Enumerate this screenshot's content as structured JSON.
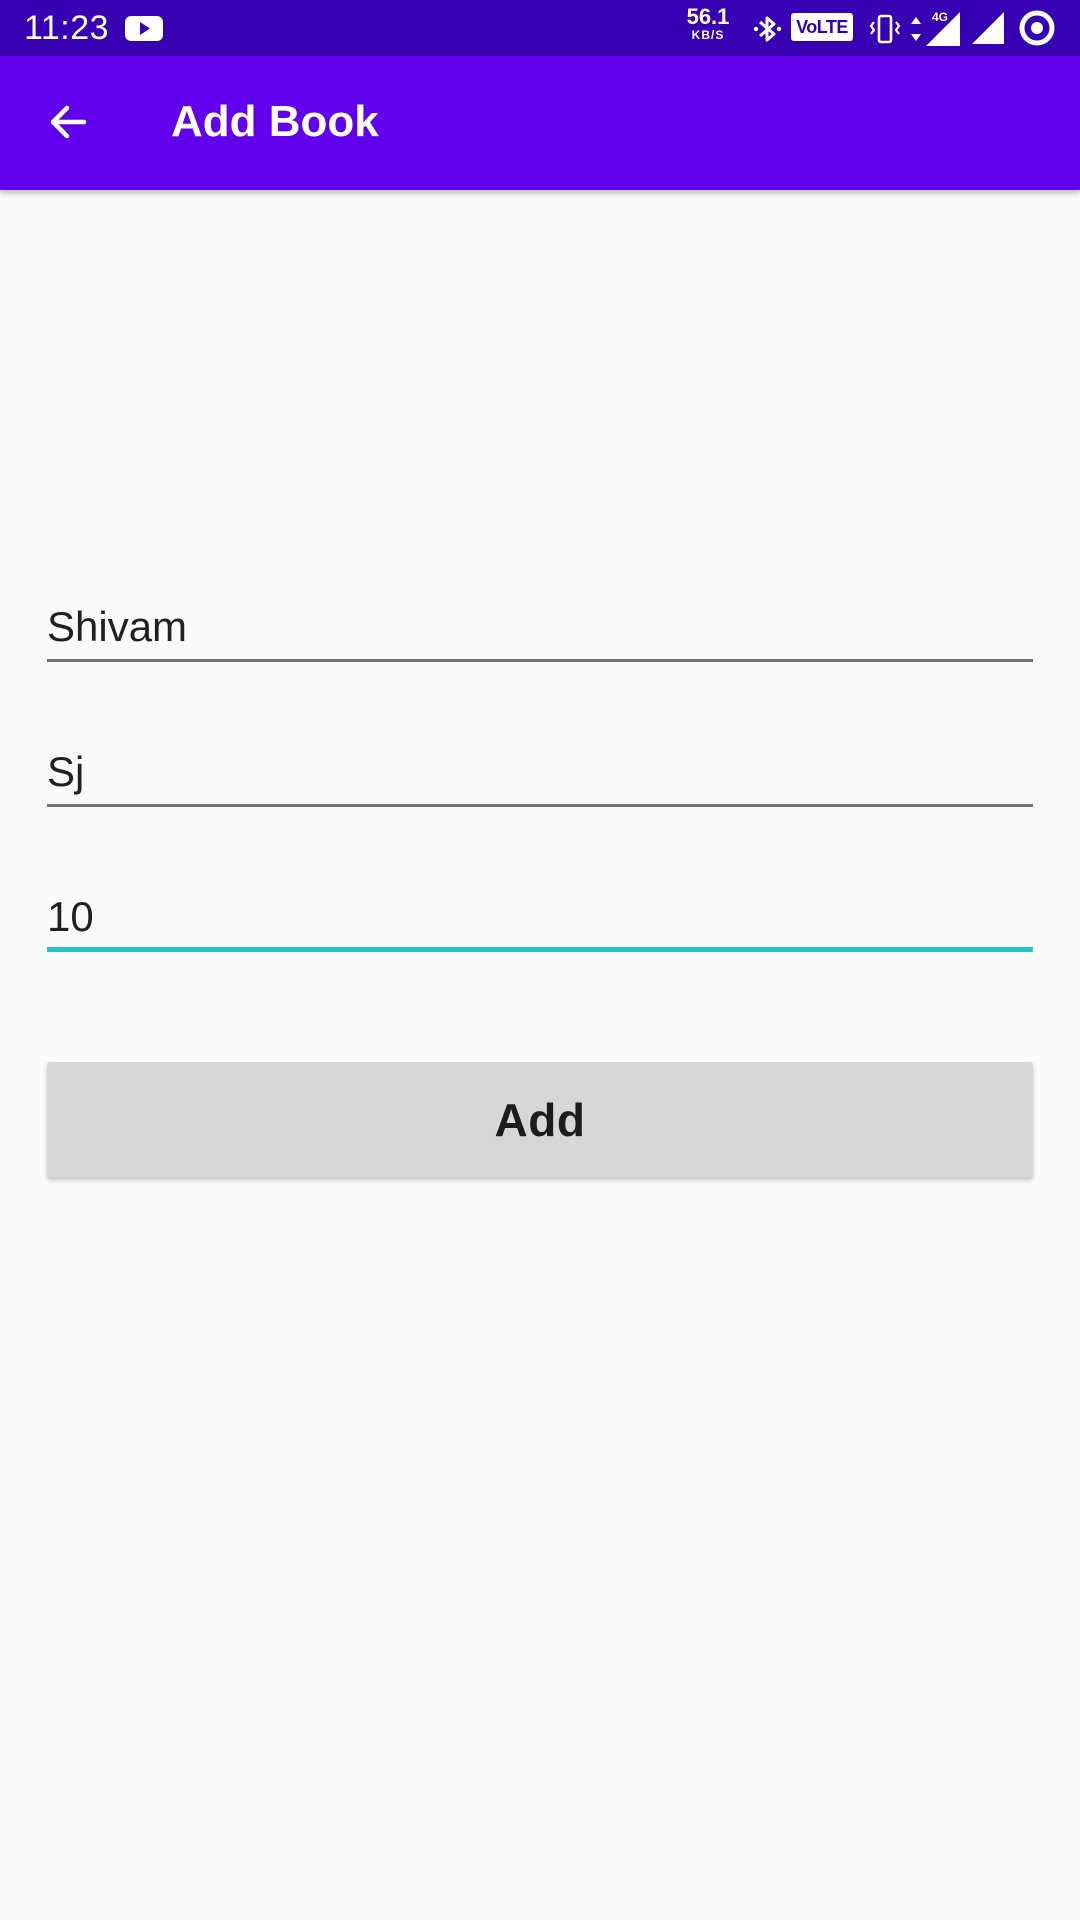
{
  "status_bar": {
    "time": "11:23",
    "net_speed_value": "56.1",
    "net_speed_unit": "KB/S",
    "volte_label": "VoLTE",
    "network_type": "4G",
    "icons": [
      "youtube-icon",
      "bluetooth-icon",
      "volte-icon",
      "vibrate-icon",
      "data-arrows-icon",
      "signal-4g-icon",
      "signal-icon",
      "circle-status-icon"
    ]
  },
  "app_bar": {
    "title": "Add Book",
    "back_icon": "arrow-back-icon"
  },
  "form": {
    "field_1": {
      "value": "Shivam"
    },
    "field_2": {
      "value": "Sj"
    },
    "field_3": {
      "value": "10",
      "focused": true
    },
    "add_label": "Add"
  },
  "colors": {
    "status_bar": "#3700b3",
    "app_bar": "#6200ee",
    "accent": "#26c6c0",
    "background": "#fafafa",
    "button": "#d6d7d7"
  }
}
